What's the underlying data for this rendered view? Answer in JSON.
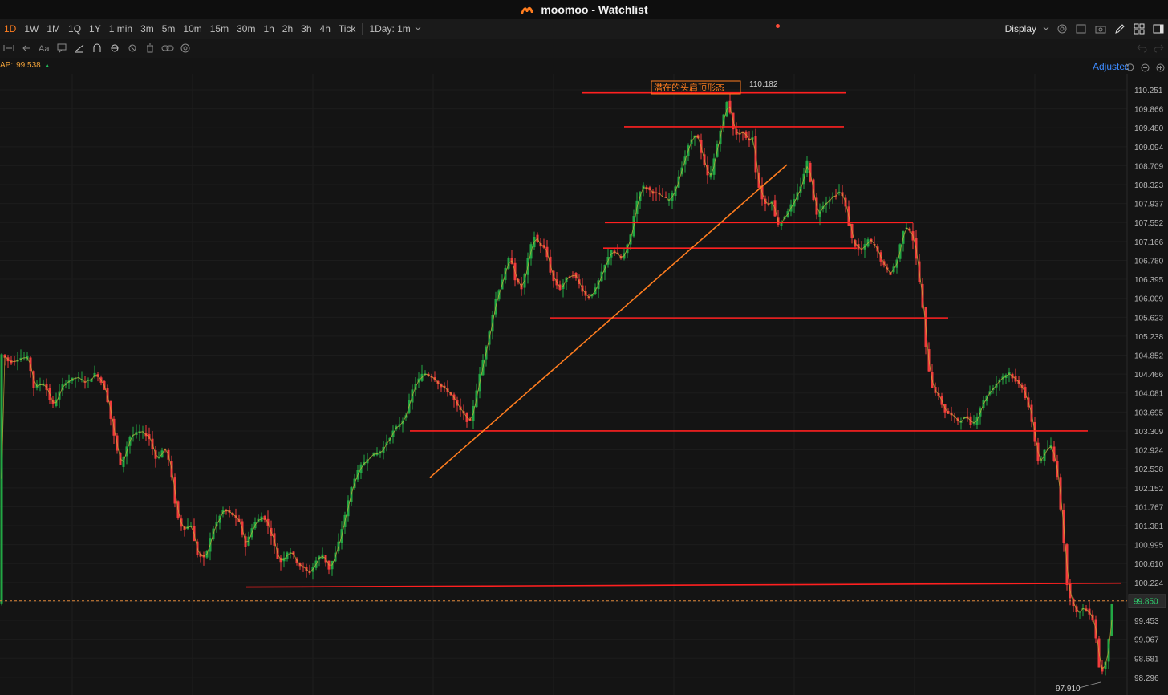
{
  "app": {
    "title": "moomoo - Watchlist"
  },
  "timeframes": [
    {
      "label": "1D",
      "active": true
    },
    {
      "label": "1W",
      "active": false
    },
    {
      "label": "1M",
      "active": false
    },
    {
      "label": "1Q",
      "active": false
    },
    {
      "label": "1Y",
      "active": false
    },
    {
      "label": "1 min",
      "active": false
    },
    {
      "label": "3m",
      "active": false
    },
    {
      "label": "5m",
      "active": false
    },
    {
      "label": "10m",
      "active": false
    },
    {
      "label": "15m",
      "active": false
    },
    {
      "label": "30m",
      "active": false
    },
    {
      "label": "1h",
      "active": false
    },
    {
      "label": "2h",
      "active": false
    },
    {
      "label": "3h",
      "active": false
    },
    {
      "label": "4h",
      "active": false
    },
    {
      "label": "Tick",
      "active": false
    }
  ],
  "period_select": {
    "label": "1Day: 1m"
  },
  "toolbar": {
    "display_label": "Display"
  },
  "indicator": {
    "label": "AP:",
    "value": "99.538"
  },
  "adjusted_label": "Adjusted",
  "colors": {
    "up": "#22a744",
    "down": "#f23c3c",
    "accent": "#ff7d1f",
    "line": "#ff2020",
    "price_tag": "#2fce6e"
  },
  "chart_data": {
    "type": "candlestick",
    "y_ticks": [
      "110.251",
      "109.866",
      "109.480",
      "109.094",
      "108.709",
      "108.323",
      "107.937",
      "107.552",
      "107.166",
      "106.780",
      "106.395",
      "106.009",
      "105.623",
      "105.238",
      "104.852",
      "104.466",
      "104.081",
      "103.695",
      "103.309",
      "102.924",
      "102.538",
      "102.152",
      "101.767",
      "101.381",
      "100.995",
      "100.610",
      "100.224",
      "99.838",
      "99.453",
      "99.067",
      "98.681",
      "98.296"
    ],
    "ylim": [
      97.7,
      110.6
    ],
    "high_label": "110.182",
    "low_label": "97.910",
    "current_price": "99.850",
    "annotation": "潜在的头肩顶形态",
    "path": [
      [
        0,
        104.9
      ],
      [
        12,
        104.7
      ],
      [
        25,
        104.8
      ],
      [
        35,
        104.8
      ],
      [
        42,
        104.2
      ],
      [
        55,
        104.3
      ],
      [
        65,
        103.8
      ],
      [
        80,
        104.3
      ],
      [
        95,
        104.4
      ],
      [
        108,
        104.3
      ],
      [
        120,
        104.5
      ],
      [
        132,
        104.1
      ],
      [
        142,
        103.2
      ],
      [
        150,
        102.6
      ],
      [
        162,
        103.2
      ],
      [
        175,
        103.3
      ],
      [
        185,
        103.2
      ],
      [
        195,
        102.7
      ],
      [
        205,
        103
      ],
      [
        212,
        102.6
      ],
      [
        220,
        101.6
      ],
      [
        228,
        101.3
      ],
      [
        238,
        101.4
      ],
      [
        245,
        100.8
      ],
      [
        255,
        100.7
      ],
      [
        265,
        101.3
      ],
      [
        278,
        101.7
      ],
      [
        290,
        101.6
      ],
      [
        300,
        101.4
      ],
      [
        305,
        100.9
      ],
      [
        315,
        101.4
      ],
      [
        328,
        101.6
      ],
      [
        338,
        101.2
      ],
      [
        348,
        100.6
      ],
      [
        360,
        100.9
      ],
      [
        372,
        100.6
      ],
      [
        385,
        100.4
      ],
      [
        395,
        100.7
      ],
      [
        402,
        100.8
      ],
      [
        410,
        100.5
      ],
      [
        420,
        100.9
      ],
      [
        430,
        101.6
      ],
      [
        440,
        102.3
      ],
      [
        450,
        102.6
      ],
      [
        460,
        102.8
      ],
      [
        475,
        102.9
      ],
      [
        490,
        103.3
      ],
      [
        505,
        103.6
      ],
      [
        515,
        104.2
      ],
      [
        528,
        104.5
      ],
      [
        540,
        104.4
      ],
      [
        550,
        104.2
      ],
      [
        560,
        104.1
      ],
      [
        570,
        103.8
      ],
      [
        580,
        103.6
      ],
      [
        585,
        103.4
      ],
      [
        592,
        104
      ],
      [
        600,
        104.6
      ],
      [
        608,
        105.2
      ],
      [
        618,
        106
      ],
      [
        628,
        106.5
      ],
      [
        636,
        106.9
      ],
      [
        642,
        106.4
      ],
      [
        650,
        106.2
      ],
      [
        658,
        106.8
      ],
      [
        665,
        107.3
      ],
      [
        672,
        107.1
      ],
      [
        680,
        107
      ],
      [
        688,
        106.4
      ],
      [
        698,
        106.2
      ],
      [
        705,
        106.4
      ],
      [
        715,
        106.5
      ],
      [
        725,
        106.2
      ],
      [
        732,
        106
      ],
      [
        742,
        106.2
      ],
      [
        752,
        106.6
      ],
      [
        762,
        107
      ],
      [
        775,
        106.8
      ],
      [
        785,
        107.2
      ],
      [
        792,
        107.9
      ],
      [
        800,
        108.3
      ],
      [
        810,
        108.2
      ],
      [
        822,
        108.1
      ],
      [
        835,
        108
      ],
      [
        842,
        108.3
      ],
      [
        852,
        108.8
      ],
      [
        860,
        109.2
      ],
      [
        868,
        109.4
      ],
      [
        876,
        108.8
      ],
      [
        884,
        108.4
      ],
      [
        892,
        109
      ],
      [
        900,
        109.6
      ],
      [
        906,
        110
      ],
      [
        910,
        109.8
      ],
      [
        916,
        109.3
      ],
      [
        925,
        109.4
      ],
      [
        932,
        109.2
      ],
      [
        938,
        109.3
      ],
      [
        942,
        108.6
      ],
      [
        948,
        108.1
      ],
      [
        955,
        107.9
      ],
      [
        962,
        108
      ],
      [
        968,
        107.5
      ],
      [
        975,
        107.6
      ],
      [
        982,
        107.8
      ],
      [
        990,
        108
      ],
      [
        998,
        108.3
      ],
      [
        1006,
        108.8
      ],
      [
        1012,
        108.2
      ],
      [
        1018,
        107.7
      ],
      [
        1025,
        107.9
      ],
      [
        1032,
        108
      ],
      [
        1040,
        108.1
      ],
      [
        1048,
        108.2
      ],
      [
        1055,
        107.8
      ],
      [
        1060,
        107.3
      ],
      [
        1068,
        107
      ],
      [
        1075,
        107
      ],
      [
        1082,
        107.2
      ],
      [
        1090,
        107.1
      ],
      [
        1100,
        106.7
      ],
      [
        1110,
        106.5
      ],
      [
        1118,
        106.8
      ],
      [
        1126,
        107.4
      ],
      [
        1132,
        107.5
      ],
      [
        1138,
        107.2
      ],
      [
        1144,
        106.6
      ],
      [
        1150,
        105.8
      ],
      [
        1155,
        104.8
      ],
      [
        1162,
        104.2
      ],
      [
        1170,
        104
      ],
      [
        1178,
        103.7
      ],
      [
        1188,
        103.6
      ],
      [
        1195,
        103.5
      ],
      [
        1205,
        103.6
      ],
      [
        1212,
        103.4
      ],
      [
        1220,
        103.7
      ],
      [
        1228,
        104
      ],
      [
        1238,
        104.2
      ],
      [
        1248,
        104.4
      ],
      [
        1258,
        104.5
      ],
      [
        1266,
        104.3
      ],
      [
        1274,
        104.2
      ],
      [
        1282,
        103.8
      ],
      [
        1288,
        103.3
      ],
      [
        1295,
        102.6
      ],
      [
        1302,
        102.9
      ],
      [
        1310,
        103
      ],
      [
        1318,
        102.4
      ],
      [
        1324,
        101.4
      ],
      [
        1330,
        100.2
      ],
      [
        1336,
        99.8
      ],
      [
        1342,
        99.6
      ],
      [
        1350,
        99.7
      ],
      [
        1358,
        99.6
      ],
      [
        1364,
        99.4
      ],
      [
        1370,
        98.5
      ],
      [
        1376,
        98.4
      ],
      [
        1382,
        99.1
      ],
      [
        1386,
        99.8
      ]
    ],
    "drawn_lines": [
      {
        "x1": 726,
        "x2": 1054,
        "y": 110.19,
        "color": "#ff2020"
      },
      {
        "x1": 778,
        "x2": 1052,
        "y": 109.5,
        "color": "#ff2020"
      },
      {
        "x1": 754,
        "x2": 1138,
        "y": 107.55,
        "color": "#ff2020"
      },
      {
        "x1": 752,
        "x2": 1068,
        "y": 107.03,
        "color": "#ff2020"
      },
      {
        "x1": 686,
        "x2": 1182,
        "y": 105.61,
        "color": "#ff2020"
      },
      {
        "x1": 511,
        "x2": 1356,
        "y": 103.31,
        "color": "#ff2020"
      },
      {
        "x1": 307,
        "x2": 1398,
        "y1": 100.13,
        "y2": 100.21,
        "color": "#ff2020"
      }
    ],
    "trendline": {
      "x1": 536,
      "y1": 102.36,
      "x2": 981,
      "y2": 108.73,
      "color": "#ff7d1f"
    }
  }
}
